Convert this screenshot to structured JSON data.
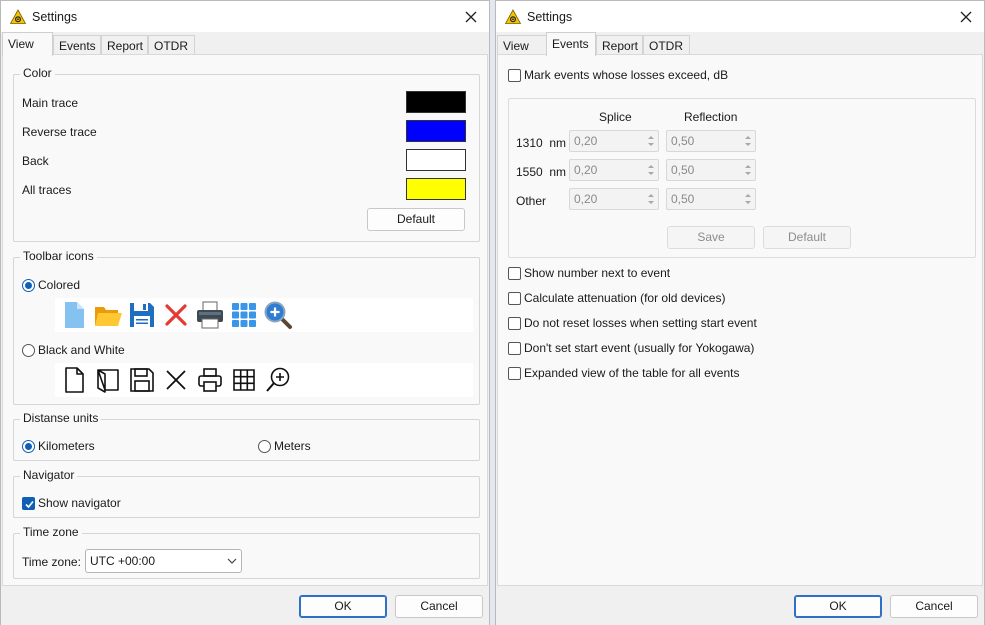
{
  "left_dialog": {
    "title": "Settings",
    "tabs": [
      {
        "label": "View"
      },
      {
        "label": "Events"
      },
      {
        "label": "Report"
      },
      {
        "label": "OTDR"
      }
    ],
    "active_tab": "View",
    "color_group": {
      "title": "Color",
      "rows": [
        {
          "label": "Main trace",
          "color": "#000000"
        },
        {
          "label": "Reverse trace",
          "color": "#0000ff"
        },
        {
          "label": "Back",
          "color": "#ffffff"
        },
        {
          "label": "All traces",
          "color": "#ffff00"
        }
      ],
      "default_button": "Default"
    },
    "toolbar_group": {
      "title": "Toolbar icons",
      "colored_label": "Colored",
      "colored_selected": true,
      "bw_label": "Black and White",
      "bw_selected": false,
      "icons": [
        "new-file-icon",
        "open-folder-icon",
        "save-icon",
        "delete-icon",
        "print-icon",
        "grid-icon",
        "zoom-in-icon"
      ]
    },
    "units_group": {
      "title": "Distanse units",
      "km_label": "Kilometers",
      "km_selected": true,
      "m_label": "Meters",
      "m_selected": false
    },
    "navigator_group": {
      "title": "Navigator",
      "show_label": "Show navigator",
      "show_checked": true
    },
    "timezone_group": {
      "title": "Time zone",
      "label": "Time zone:",
      "value": "UTC +00:00"
    },
    "ok_label": "OK",
    "cancel_label": "Cancel"
  },
  "right_dialog": {
    "title": "Settings",
    "tabs": [
      {
        "label": "View"
      },
      {
        "label": "Events"
      },
      {
        "label": "Report"
      },
      {
        "label": "OTDR"
      }
    ],
    "active_tab": "Events",
    "mark_label": "Mark events whose losses exceed, dB",
    "mark_checked": false,
    "thresholds": {
      "col_splice": "Splice",
      "col_reflection": "Reflection",
      "rows": [
        {
          "label": "1310  nm",
          "splice": "0,20",
          "reflection": "0,50"
        },
        {
          "label": "1550  nm",
          "splice": "0,20",
          "reflection": "0,50"
        },
        {
          "label": "Other",
          "splice": "0,20",
          "reflection": "0,50"
        }
      ],
      "save_label": "Save",
      "default_label": "Default"
    },
    "options": [
      {
        "label": "Show number next to event",
        "checked": false
      },
      {
        "label": "Calculate attenuation (for old devices)",
        "checked": false
      },
      {
        "label": "Do not reset losses when setting start event",
        "checked": false
      },
      {
        "label": "Don't set start event (usually for Yokogawa)",
        "checked": false
      },
      {
        "label": "Expanded view of the table for all events",
        "checked": false
      }
    ],
    "ok_label": "OK",
    "cancel_label": "Cancel"
  }
}
